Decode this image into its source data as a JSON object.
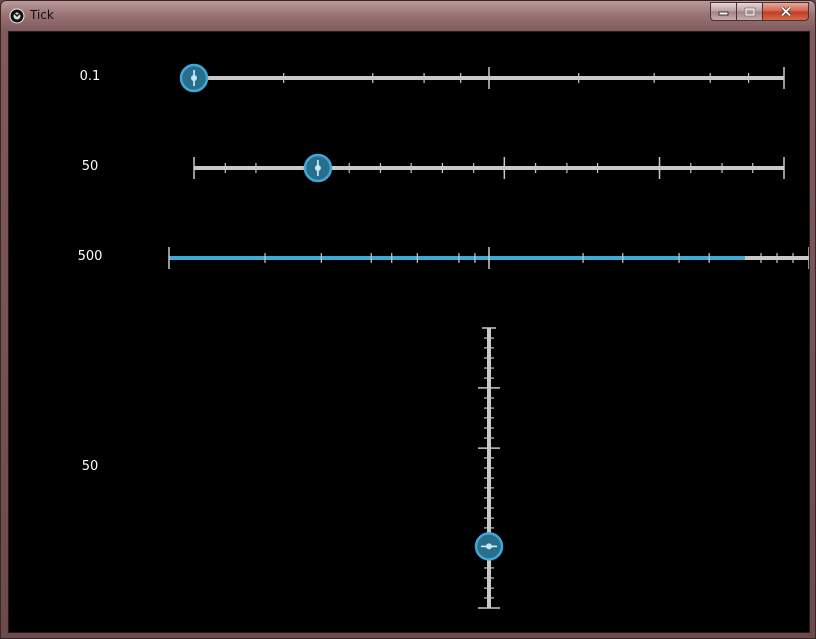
{
  "window": {
    "title": "Tick",
    "buttons": {
      "minimize": "minimize",
      "maximize": "maximize",
      "close": "close"
    }
  },
  "sliders": [
    {
      "label": "0.1",
      "orientation": "horizontal",
      "value_fraction": 0.0,
      "filled": false
    },
    {
      "label": "50",
      "orientation": "horizontal",
      "value_fraction": 0.21,
      "filled": false
    },
    {
      "label": "500",
      "orientation": "horizontal",
      "value_fraction": 0.9,
      "filled": true
    },
    {
      "label": "50",
      "orientation": "vertical",
      "value_fraction": 0.78,
      "filled": false
    }
  ],
  "colors": {
    "accent": "#3fa9d6",
    "track": "#c8c8c8",
    "background": "#000000",
    "knob_fill": "#2a6e8e"
  }
}
